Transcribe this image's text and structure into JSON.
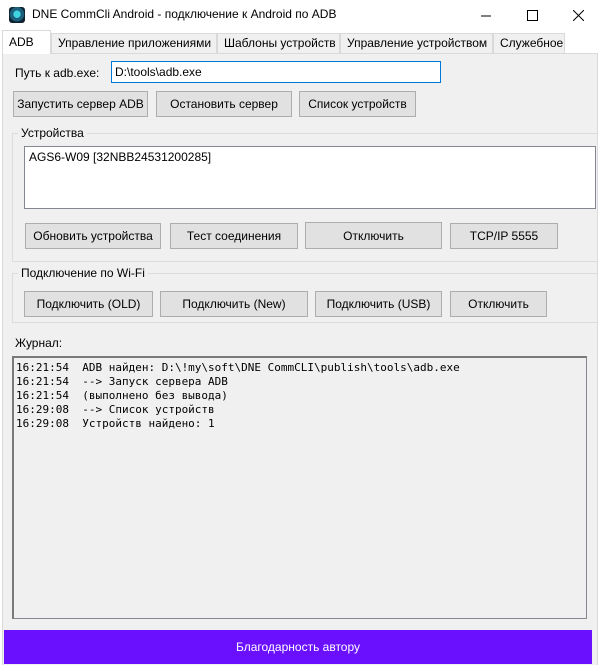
{
  "window": {
    "title": "DNE CommCli Android - подключение к Android по ADB"
  },
  "tabs": [
    {
      "label": "ADB",
      "active": true
    },
    {
      "label": "Управление приложениями"
    },
    {
      "label": "Шаблоны устройств"
    },
    {
      "label": "Управление устройством"
    },
    {
      "label": "Служебное"
    }
  ],
  "adb": {
    "path_label": "Путь к adb.exe:",
    "path_value": "D:\\tools\\adb.exe",
    "start_server": "Запустить сервер ADB",
    "stop_server": "Остановить сервер",
    "list_devices": "Список устройств"
  },
  "devices": {
    "group_label": "Устройства",
    "items": [
      "AGS6-W09  [32NBB24531200285]"
    ],
    "refresh": "Обновить устройства",
    "test_connection": "Тест соединения",
    "disconnect": "Отключить",
    "tcpip": "TCP/IP 5555"
  },
  "wifi": {
    "group_label": "Подключение по Wi-Fi",
    "connect_old": "Подключить (OLD)",
    "connect_new": "Подключить (New)",
    "connect_usb": "Подключить (USB)",
    "disconnect": "Отключить"
  },
  "log": {
    "label": "Журнал:",
    "lines": [
      "16:21:54  ADB найден: D:\\!my\\soft\\DNE CommCLI\\publish\\tools\\adb.exe",
      "16:21:54  --> Запуск сервера ADB",
      "16:21:54  (выполнено без вывода)",
      "16:29:08  --> Список устройств",
      "16:29:08  Устройств найдено: 1"
    ]
  },
  "footer": {
    "thanks_button": "Благодарность автору"
  },
  "colors": {
    "accent": "#6a10ff",
    "focus": "#0078d7",
    "panel": "#f0f0f0"
  }
}
